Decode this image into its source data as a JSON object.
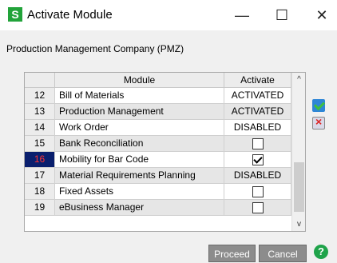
{
  "window": {
    "logo_letter": "S",
    "title": "Activate Module",
    "minimize": "—",
    "maximize": "☐",
    "close": "✕"
  },
  "company_label": "Production Management Company (PMZ)",
  "grid": {
    "columns": {
      "module": "Module",
      "activate": "Activate"
    },
    "rows": [
      {
        "num": "12",
        "module": "Bill of Materials",
        "activate": "ACTIVATED",
        "checkbox": null
      },
      {
        "num": "13",
        "module": "Production Management",
        "activate": "ACTIVATED",
        "checkbox": null
      },
      {
        "num": "14",
        "module": "Work Order",
        "activate": "DISABLED",
        "checkbox": null
      },
      {
        "num": "15",
        "module": "Bank Reconciliation",
        "activate": "",
        "checkbox": false
      },
      {
        "num": "16",
        "module": "Mobility for Bar Code",
        "activate": "",
        "checkbox": true
      },
      {
        "num": "17",
        "module": "Material Requirements Planning",
        "activate": "DISABLED",
        "checkbox": null
      },
      {
        "num": "18",
        "module": "Fixed Assets",
        "activate": "",
        "checkbox": false
      },
      {
        "num": "19",
        "module": "eBusiness Manager",
        "activate": "",
        "checkbox": false
      }
    ],
    "selected_row": "16",
    "scroll_up": "^",
    "scroll_down": "v"
  },
  "buttons": {
    "proceed": "Proceed",
    "cancel": "Cancel",
    "help": "?"
  },
  "colors": {
    "selected_row_bg": "#0a1f6e",
    "selected_row_text": "#ff3333",
    "logo": "#22a33a",
    "button_bg": "#8c8c8c"
  },
  "icons": [
    "app-logo-icon",
    "accept-icon",
    "reject-icon",
    "help-icon"
  ]
}
